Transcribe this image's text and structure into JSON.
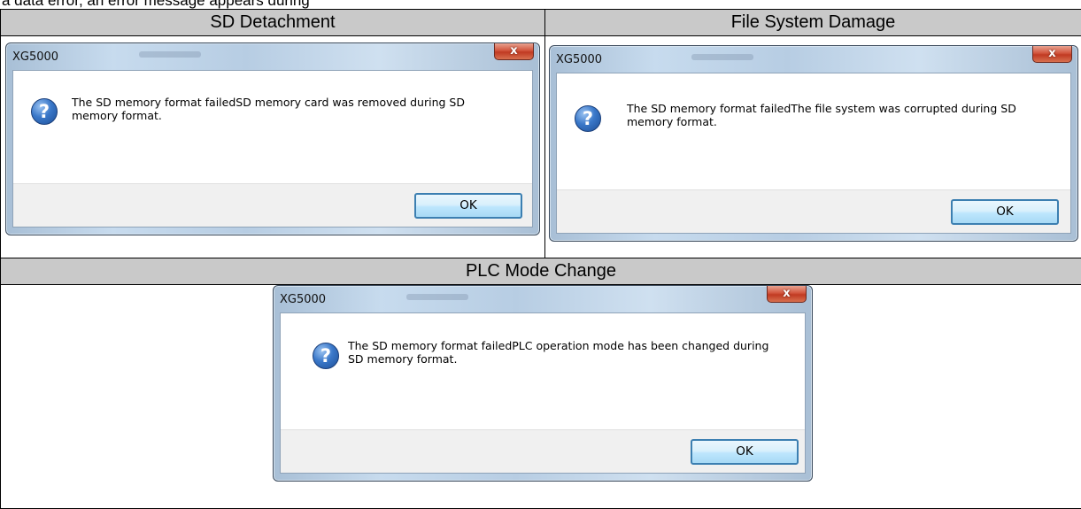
{
  "intro_text": "a data error, an error message appears during",
  "headers": {
    "sd_detachment": "SD Detachment",
    "file_system_damage": "File System Damage",
    "plc_mode_change": "PLC Mode Change"
  },
  "dialogs": [
    {
      "title": "XG5000",
      "close_label": "x",
      "icon": "question-icon",
      "message": "The SD memory format failedSD memory card was removed during SD memory format.",
      "ok_label": "OK"
    },
    {
      "title": "XG5000",
      "close_label": "x",
      "icon": "question-icon",
      "message": "The SD memory format failedThe file system was corrupted during SD memory format.",
      "ok_label": "OK"
    },
    {
      "title": "XG5000",
      "close_label": "x",
      "icon": "question-icon",
      "message": "The SD memory format failedPLC operation mode has been changed during SD memory format.",
      "ok_label": "OK"
    }
  ]
}
